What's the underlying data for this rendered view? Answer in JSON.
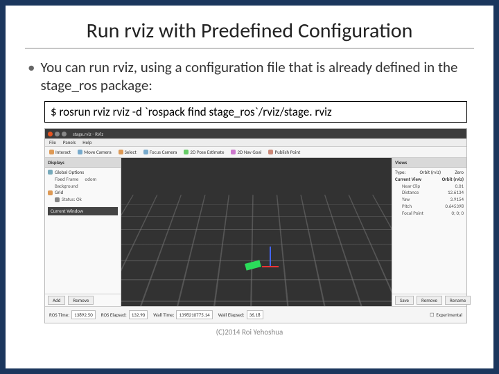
{
  "title": "Run rviz with Predefined Configuration",
  "bullet_text": "You can run rviz, using a configuration file that is already defined in the stage_ros package:",
  "command": "$ rosrun rviz rviz -d `rospack find stage_ros`/rviz/stage. rviz",
  "footer": "(C)2014 Roi Yehoshua",
  "rviz": {
    "window_title": "stage.rviz - RViz",
    "menu": [
      "File",
      "Panels",
      "Help"
    ],
    "tools": {
      "interact": "Interact",
      "move_camera": "Move Camera",
      "select": "Select",
      "focus": "Focus Camera",
      "pose_est": "2D Pose Estimate",
      "nav_goal": "2D Nav Goal",
      "publish": "Publish Point"
    },
    "displays": {
      "header": "Displays",
      "global": "Global Options",
      "fixed_frame": "Fixed Frame",
      "fixed_frame_val": "odom",
      "bgcolor": "Background",
      "grid": "Grid",
      "status_ok": "Status: Ok",
      "current_window": "Current Window",
      "add": "Add",
      "remove": "Remove"
    },
    "views": {
      "header": "Views",
      "type_label": "Type:",
      "type_val": "Orbit (rviz)",
      "zero": "Zero",
      "current": "Current View",
      "current_val": "Orbit (rviz)",
      "near": "Near Clip",
      "near_val": "0.01",
      "distance": "Distance",
      "distance_val": "12.6134",
      "yaw": "Yaw",
      "yaw_val": "3.9154",
      "pitch": "Pitch",
      "pitch_val": "0.645398",
      "focal": "Focal Point",
      "focal_val": "0; 0; 0",
      "save": "Save",
      "remove": "Remove",
      "rename": "Rename"
    },
    "status": {
      "ros_time_label": "ROS Time:",
      "ros_time": "13892.50",
      "ros_elapsed_label": "ROS Elapsed:",
      "ros_elapsed": "132.90",
      "wall_time_label": "Wall Time:",
      "wall_time": "1398210775.14",
      "wall_elapsed_label": "Wall Elapsed:",
      "wall_elapsed": "36.18",
      "experimental": "Experimental"
    }
  }
}
